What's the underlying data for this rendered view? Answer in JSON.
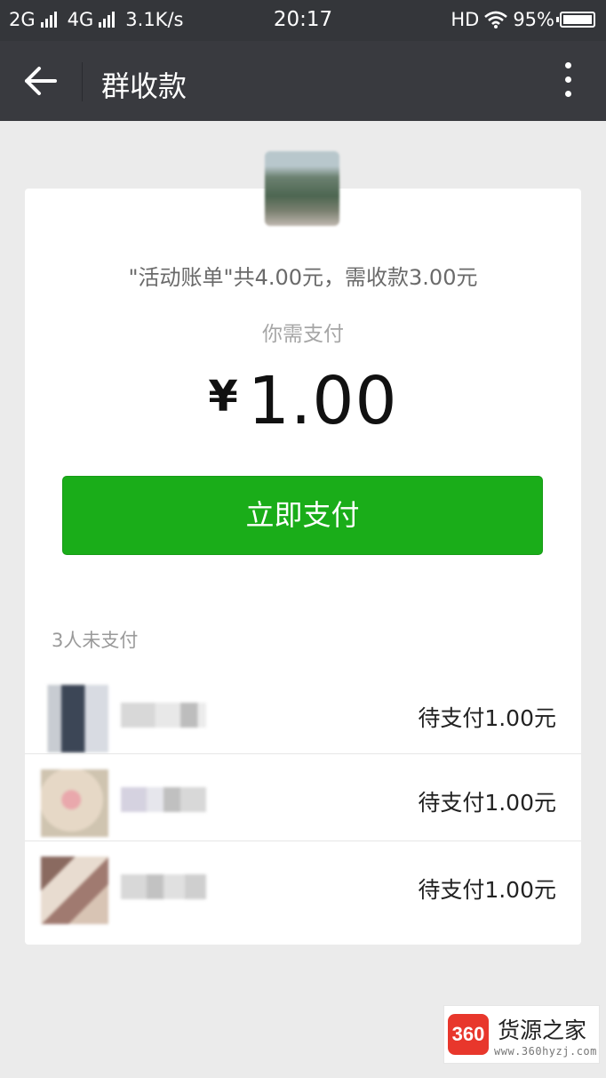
{
  "status_bar": {
    "network_1": "2G",
    "network_2": "4G",
    "speed": "3.1K/s",
    "time": "20:17",
    "hd": "HD",
    "battery": "95%"
  },
  "nav": {
    "title": "群收款",
    "back_icon": "arrow-left-icon",
    "more_icon": "more-vertical-icon"
  },
  "bill": {
    "description": "\"活动账单\"共4.00元，需收款3.00元",
    "prompt": "你需支付",
    "currency": "¥",
    "amount": "1.00",
    "pay_button": "立即支付"
  },
  "unpaid": {
    "header": "3人未支付",
    "members": [
      {
        "status": "待支付1.00元"
      },
      {
        "status": "待支付1.00元"
      },
      {
        "status": "待支付1.00元"
      }
    ]
  },
  "watermark": {
    "logo": "360",
    "title": "货源之家",
    "url": "www.360hyzj.com"
  },
  "colors": {
    "accent_green": "#1aad19",
    "nav_background": "#393a3f",
    "page_background": "#ebebeb"
  }
}
